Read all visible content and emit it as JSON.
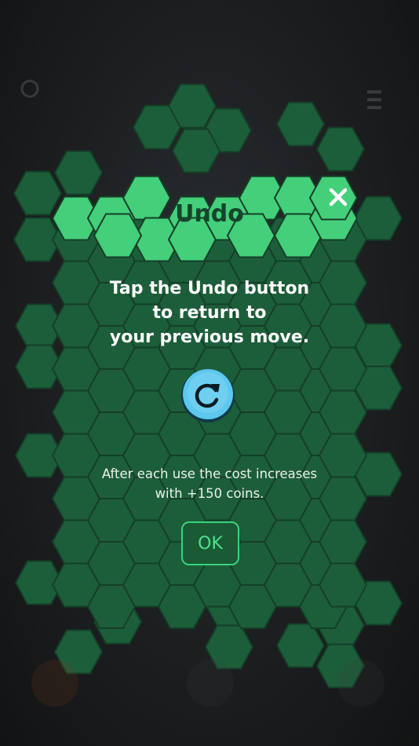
{
  "dialog": {
    "title": "Undo",
    "message_lines": [
      "Tap the Undo button",
      "to return to",
      "your previous move."
    ],
    "cost_lines": [
      "After each use the cost increases",
      "with +150 coins."
    ],
    "ok_label": "OK",
    "icons": {
      "close": "close-icon",
      "undo": "undo-icon"
    }
  },
  "colors": {
    "panel_hex": "#1d5e3a",
    "panel_edge": "#143f28",
    "header_hex": "#44cf7a",
    "title_text": "#15452b",
    "ok_border": "#3ad27d",
    "undo_button": "#5cc8ee",
    "background": "#1f2224"
  }
}
